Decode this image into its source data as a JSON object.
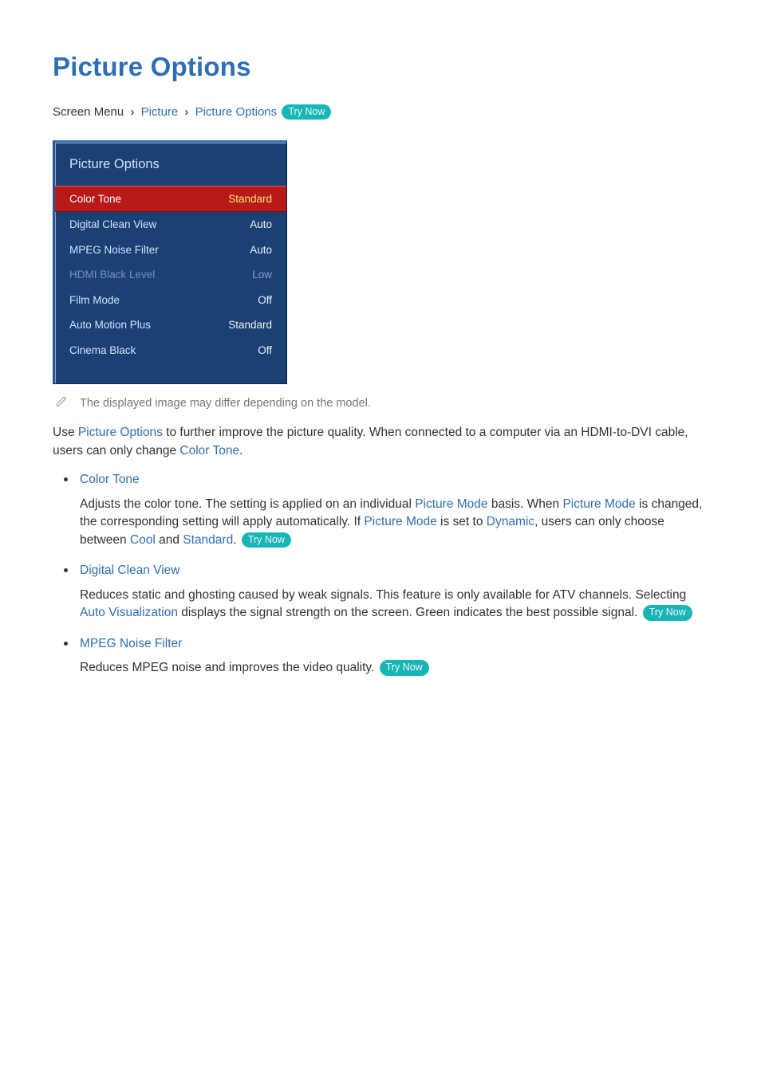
{
  "page": {
    "title": "Picture Options"
  },
  "breadcrumb": {
    "root": "Screen Menu",
    "level1": "Picture",
    "level2": "Picture Options",
    "try_now": "Try Now"
  },
  "menu": {
    "header": "Picture Options",
    "rows": [
      {
        "label": "Color Tone",
        "value": "Standard",
        "selected": true,
        "disabled": false
      },
      {
        "label": "Digital Clean View",
        "value": "Auto",
        "selected": false,
        "disabled": false
      },
      {
        "label": "MPEG Noise Filter",
        "value": "Auto",
        "selected": false,
        "disabled": false
      },
      {
        "label": "HDMI Black Level",
        "value": "Low",
        "selected": false,
        "disabled": true
      },
      {
        "label": "Film Mode",
        "value": "Off",
        "selected": false,
        "disabled": false
      },
      {
        "label": "Auto Motion Plus",
        "value": "Standard",
        "selected": false,
        "disabled": false
      },
      {
        "label": "Cinema Black",
        "value": "Off",
        "selected": false,
        "disabled": false
      }
    ]
  },
  "note": {
    "text": "The displayed image may differ depending on the model."
  },
  "intro": {
    "pre": "Use ",
    "k1": "Picture Options",
    "mid": " to further improve the picture quality. When connected to a computer via an HDMI-to-DVI cable, users can only change ",
    "k2": "Color Tone",
    "post": "."
  },
  "features": [
    {
      "title": "Color Tone",
      "desc": {
        "t0": "Adjusts the color tone. The setting is applied on an individual ",
        "k0": "Picture Mode",
        "t1": " basis. When ",
        "k1": "Picture Mode",
        "t2": " is changed, the corresponding setting will apply automatically. If ",
        "k2": "Picture Mode",
        "t3": " is set to ",
        "k3": "Dynamic",
        "t4": ", users can only choose between ",
        "k4": "Cool",
        "t5": " and ",
        "k5": "Standard",
        "t6": ". "
      },
      "try_now": "Try Now"
    },
    {
      "title": "Digital Clean View",
      "desc": {
        "t0": "Reduces static and ghosting caused by weak signals. This feature is only available for ATV channels. Selecting ",
        "k0": "Auto Visualization",
        "t1": " displays the signal strength on the screen. Green indicates the best possible signal. "
      },
      "try_now": "Try Now"
    },
    {
      "title": "MPEG Noise Filter",
      "desc": {
        "t0": "Reduces MPEG noise and improves the video quality. "
      },
      "try_now": "Try Now"
    }
  ]
}
